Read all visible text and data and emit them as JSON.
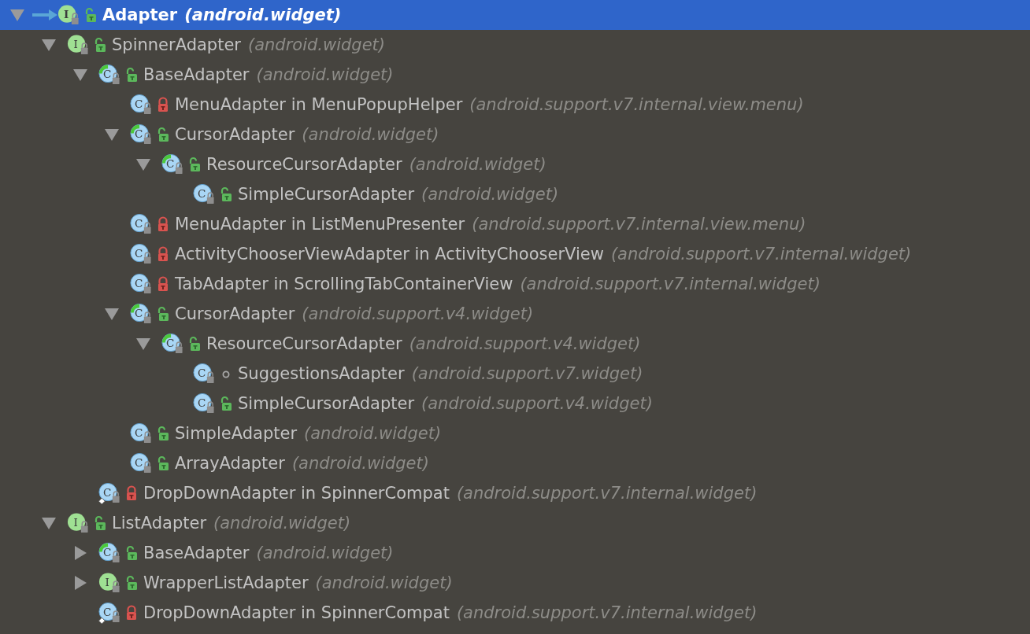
{
  "hierarchy": {
    "root": {
      "name": "Adapter",
      "package": "(android.widget)",
      "kind": "interface",
      "letter": "I",
      "access": {
        "kind": "public"
      },
      "base": true,
      "expanded": true,
      "selected": true,
      "children": [
        {
          "name": "SpinnerAdapter",
          "package": "(android.widget)",
          "kind": "interface",
          "letter": "I",
          "access": {
            "kind": "public"
          },
          "expanded": true,
          "selected": false,
          "children": [
            {
              "name": "BaseAdapter",
              "package": "(android.widget)",
              "kind": "abstract",
              "letter": "C",
              "access": {
                "kind": "public"
              },
              "expanded": true,
              "selected": false,
              "children": [
                {
                  "name": "MenuAdapter in MenuPopupHelper",
                  "package": "(android.support.v7.internal.view.menu)",
                  "kind": "class",
                  "letter": "C",
                  "access": {
                    "kind": "private"
                  },
                  "selected": false
                },
                {
                  "name": "CursorAdapter",
                  "package": "(android.widget)",
                  "kind": "abstract",
                  "letter": "C",
                  "access": {
                    "kind": "public"
                  },
                  "expanded": true,
                  "selected": false,
                  "children": [
                    {
                      "name": "ResourceCursorAdapter",
                      "package": "(android.widget)",
                      "kind": "abstract",
                      "letter": "C",
                      "access": {
                        "kind": "public"
                      },
                      "expanded": true,
                      "selected": false,
                      "children": [
                        {
                          "name": "SimpleCursorAdapter",
                          "package": "(android.widget)",
                          "kind": "class",
                          "letter": "C",
                          "access": {
                            "kind": "public"
                          },
                          "selected": false
                        }
                      ]
                    }
                  ]
                },
                {
                  "name": "MenuAdapter in ListMenuPresenter",
                  "package": "(android.support.v7.internal.view.menu)",
                  "kind": "class",
                  "letter": "C",
                  "access": {
                    "kind": "private"
                  },
                  "selected": false
                },
                {
                  "name": "ActivityChooserViewAdapter in ActivityChooserView",
                  "package": "(android.support.v7.internal.widget)",
                  "kind": "class",
                  "letter": "C",
                  "access": {
                    "kind": "private"
                  },
                  "selected": false
                },
                {
                  "name": "TabAdapter in ScrollingTabContainerView",
                  "package": "(android.support.v7.internal.widget)",
                  "kind": "class",
                  "letter": "C",
                  "access": {
                    "kind": "private"
                  },
                  "selected": false
                },
                {
                  "name": "CursorAdapter",
                  "package": "(android.support.v4.widget)",
                  "kind": "abstract",
                  "letter": "C",
                  "access": {
                    "kind": "public"
                  },
                  "expanded": true,
                  "selected": false,
                  "children": [
                    {
                      "name": "ResourceCursorAdapter",
                      "package": "(android.support.v4.widget)",
                      "kind": "abstract",
                      "letter": "C",
                      "access": {
                        "kind": "public"
                      },
                      "expanded": true,
                      "selected": false,
                      "children": [
                        {
                          "name": "SuggestionsAdapter",
                          "package": "(android.support.v7.widget)",
                          "kind": "class",
                          "letter": "C",
                          "access": {
                            "kind": "package"
                          },
                          "selected": false
                        },
                        {
                          "name": "SimpleCursorAdapter",
                          "package": "(android.support.v4.widget)",
                          "kind": "class",
                          "letter": "C",
                          "access": {
                            "kind": "public"
                          },
                          "selected": false
                        }
                      ]
                    }
                  ]
                },
                {
                  "name": "SimpleAdapter",
                  "package": "(android.widget)",
                  "kind": "class",
                  "letter": "C",
                  "access": {
                    "kind": "public"
                  },
                  "selected": false
                },
                {
                  "name": "ArrayAdapter",
                  "package": "(android.widget)",
                  "kind": "class",
                  "letter": "C",
                  "access": {
                    "kind": "public"
                  },
                  "selected": false
                }
              ]
            },
            {
              "name": "DropDownAdapter in SpinnerCompat",
              "package": "(android.support.v7.internal.widget)",
              "kind": "static-class",
              "letter": "C",
              "access": {
                "kind": "private"
              },
              "selected": false
            }
          ]
        },
        {
          "name": "ListAdapter",
          "package": "(android.widget)",
          "kind": "interface",
          "letter": "I",
          "access": {
            "kind": "public"
          },
          "expanded": true,
          "selected": false,
          "children": [
            {
              "name": "BaseAdapter",
              "package": "(android.widget)",
              "kind": "abstract",
              "letter": "C",
              "access": {
                "kind": "public"
              },
              "expanded": false,
              "selected": false
            },
            {
              "name": "WrapperListAdapter",
              "package": "(android.widget)",
              "kind": "interface",
              "letter": "I",
              "access": {
                "kind": "public"
              },
              "expanded": false,
              "selected": false
            },
            {
              "name": "DropDownAdapter in SpinnerCompat",
              "package": "(android.support.v7.internal.widget)",
              "kind": "static-class",
              "letter": "C",
              "access": {
                "kind": "private"
              },
              "selected": false
            }
          ]
        }
      ]
    }
  }
}
